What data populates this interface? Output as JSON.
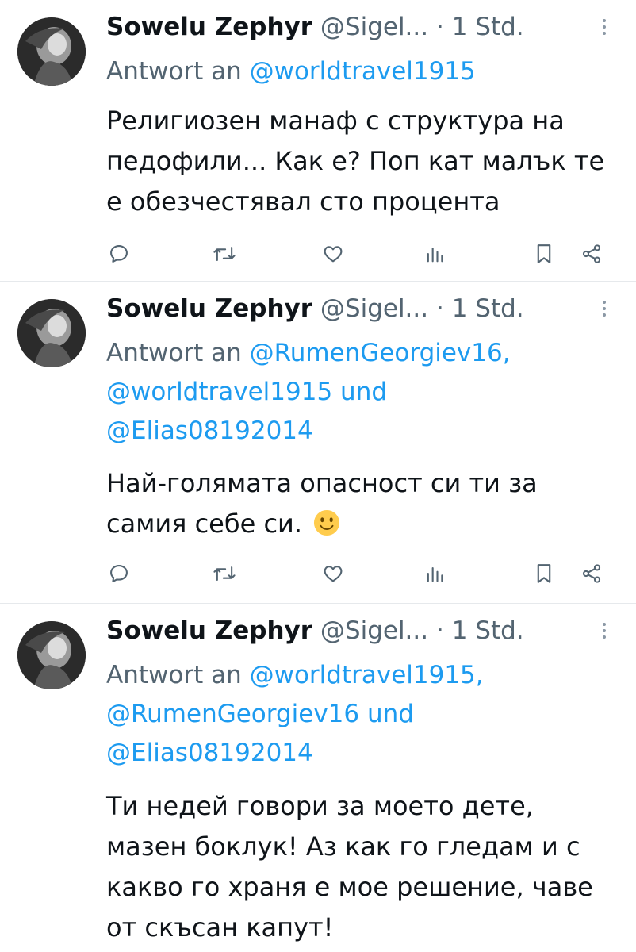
{
  "colors": {
    "text": "#0f1419",
    "secondary": "#536471",
    "mention": "#1d9bf0",
    "divider": "#e6e9ec",
    "icon": "#536471"
  },
  "icons": [
    "reply-icon",
    "retweet-icon",
    "like-icon",
    "views-icon",
    "bookmark-icon",
    "share-icon",
    "more-icon"
  ],
  "tweets": [
    {
      "author_name": "Sowelu Zephyr",
      "author_handle": "@Sigel...",
      "time": "· 1 Std.",
      "reply_prefix": "Antwort an",
      "mentions": [
        "@worldtravel1915"
      ],
      "text": "Религиозен манаф с структура на педофили... Как е? Поп кат малък те е обезчестявал сто процента"
    },
    {
      "author_name": "Sowelu Zephyr",
      "author_handle": "@Sigel...",
      "time": "· 1 Std.",
      "reply_prefix": "Antwort an",
      "mentions": [
        "@RumenGeorgiev16,",
        "@worldtravel1915",
        "@Elias08192014"
      ],
      "joiner": "und",
      "text": "Най-голямата опасност си ти за самия себе си.",
      "emoji": "slightly-smiling-face"
    },
    {
      "author_name": "Sowelu Zephyr",
      "author_handle": "@Sigel...",
      "time": "· 1 Std.",
      "reply_prefix": "Antwort an",
      "mentions": [
        "@worldtravel1915,",
        "@RumenGeorgiev16",
        "@Elias08192014"
      ],
      "joiner": "und",
      "text": "Ти недей говори за моето дете, мазен боклук! Аз как го гледам и с какво го храня е мое решение, чаве от скъсан капут!"
    }
  ]
}
